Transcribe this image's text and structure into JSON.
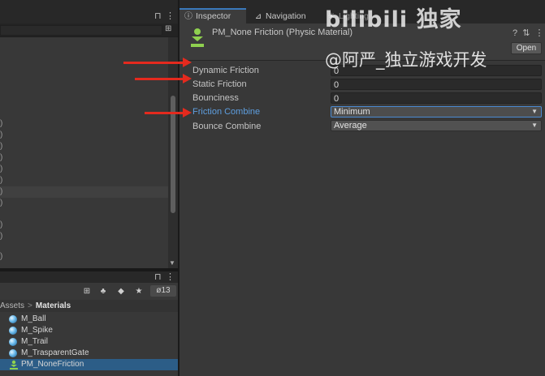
{
  "hierarchy": {
    "row_markers": [
      ")",
      ")",
      ")",
      ")",
      ")",
      ")",
      ")",
      ")",
      ")",
      ")",
      ")"
    ]
  },
  "project": {
    "hidden_count": "13",
    "breadcrumb": [
      "Assets",
      "Materials"
    ],
    "assets": [
      {
        "name": "M_Ball",
        "type": "material"
      },
      {
        "name": "M_Spike",
        "type": "material"
      },
      {
        "name": "M_Trail",
        "type": "material"
      },
      {
        "name": "M_TrasparentGate",
        "type": "material"
      },
      {
        "name": "PM_NoneFriction",
        "type": "physic-material",
        "selected": true
      }
    ]
  },
  "inspector": {
    "tabs": [
      {
        "label": "Inspector",
        "icon": "info-icon",
        "active": true
      },
      {
        "label": "Navigation",
        "icon": "navigation-icon"
      },
      {
        "label": "Lighting",
        "icon": "light-icon"
      }
    ],
    "asset_title": "PM_None Friction (Physic Material)",
    "open_label": "Open",
    "properties": [
      {
        "label": "Dynamic Friction",
        "value": "0",
        "kind": "field"
      },
      {
        "label": "Static Friction",
        "value": "0",
        "kind": "field"
      },
      {
        "label": "Bounciness",
        "value": "0",
        "kind": "field"
      },
      {
        "label": "Friction Combine",
        "value": "Minimum",
        "kind": "dropdown",
        "highlighted": true
      },
      {
        "label": "Bounce Combine",
        "value": "Average",
        "kind": "dropdown"
      }
    ]
  },
  "watermark": {
    "logo_text": "bilibili 独家",
    "handle": "@阿严_独立游戏开发"
  },
  "colors": {
    "accent_blue": "#3a79bb",
    "highlight_label": "#5e9fe0",
    "selection": "#2c5d87",
    "annotation_red": "#e42a1e"
  }
}
